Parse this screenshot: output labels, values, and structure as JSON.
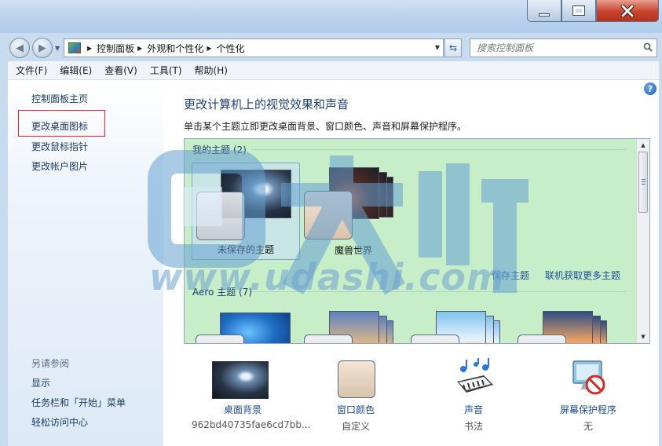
{
  "address": {
    "crumbs": [
      "控制面板",
      "外观和个性化",
      "个性化"
    ]
  },
  "search": {
    "placeholder": "搜索控制面板"
  },
  "menu": [
    "文件(F)",
    "编辑(E)",
    "查看(V)",
    "工具(T)",
    "帮助(H)"
  ],
  "sidebar": {
    "links": [
      "控制面板主页",
      "更改桌面图标",
      "更改鼠标指针",
      "更改帐户图片"
    ],
    "see_also_title": "另请参阅",
    "see_also": [
      "显示",
      "任务栏和「开始」菜单",
      "轻松访问中心"
    ]
  },
  "main": {
    "title": "更改计算机上的视觉效果和声音",
    "subtitle": "单击某个主题立即更改桌面背景、窗口颜色、声音和屏幕保护程序。",
    "my_themes_title": "我的主题 (2)",
    "my_themes": [
      "未保存的主题",
      "魔兽世界"
    ],
    "save_theme": "保存主题",
    "get_more": "联机获取更多主题",
    "aero_title": "Aero 主题 (7)"
  },
  "bottom": {
    "desktop_bg": {
      "label": "桌面背景",
      "value": "962bd40735fae6cd7bb..."
    },
    "window_color": {
      "label": "窗口颜色",
      "value": "自定义"
    },
    "sound": {
      "label": "声音",
      "value": "书法"
    },
    "screensaver": {
      "label": "屏幕保护程序",
      "value": "无"
    }
  },
  "watermark": {
    "text": "www.udashi.com"
  },
  "colors": {
    "theme_bg": "#c7eec9",
    "link": "#1f4c97",
    "highlight_box": "#e0262a"
  }
}
